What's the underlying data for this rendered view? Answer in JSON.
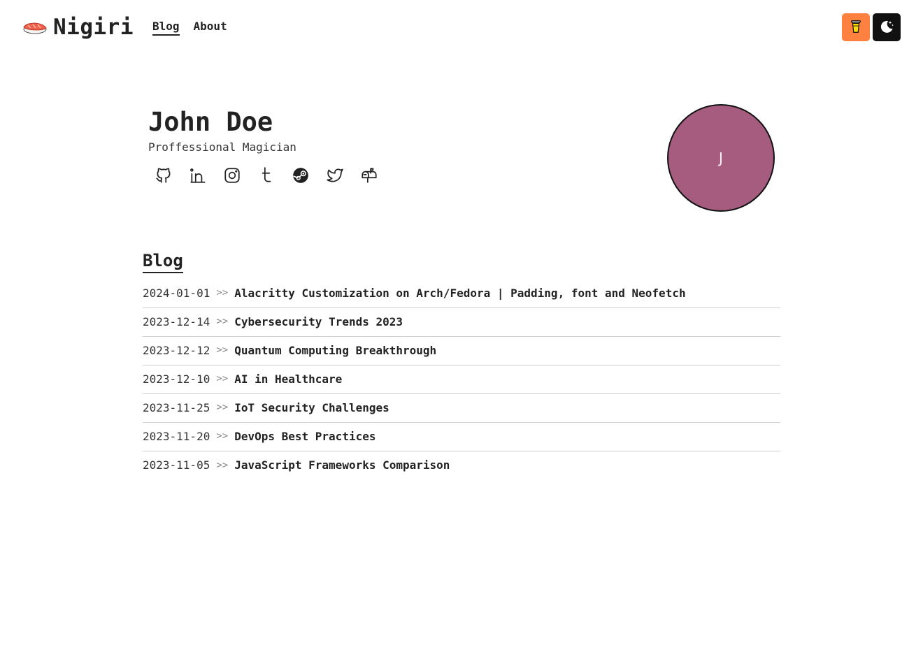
{
  "header": {
    "logo_text": "Nigiri",
    "nav": [
      {
        "label": "Blog",
        "active": true
      },
      {
        "label": "About",
        "active": false
      }
    ],
    "buttons": [
      {
        "icon": "coffee-cup-icon",
        "color": "#ff813f"
      },
      {
        "icon": "moon-icon",
        "color": "#111111"
      }
    ]
  },
  "profile": {
    "name": "John Doe",
    "title": "Proffessional Magician",
    "avatar_initial": "J",
    "avatar_color": "#a65c7e",
    "socials": [
      "github-icon",
      "linkedin-icon",
      "instagram-icon",
      "tumblr-icon",
      "steam-icon",
      "twitter-icon",
      "mailbox-icon"
    ]
  },
  "blog": {
    "heading": "Blog",
    "separator": ">>",
    "posts": [
      {
        "date": "2024-01-01",
        "title": "Alacritty Customization on Arch/Fedora | Padding, font and Neofetch"
      },
      {
        "date": "2023-12-14",
        "title": "Cybersecurity Trends 2023"
      },
      {
        "date": "2023-12-12",
        "title": "Quantum Computing Breakthrough"
      },
      {
        "date": "2023-12-10",
        "title": "AI in Healthcare"
      },
      {
        "date": "2023-11-25",
        "title": "IoT Security Challenges"
      },
      {
        "date": "2023-11-20",
        "title": "DevOps Best Practices"
      },
      {
        "date": "2023-11-05",
        "title": "JavaScript Frameworks Comparison"
      }
    ]
  }
}
